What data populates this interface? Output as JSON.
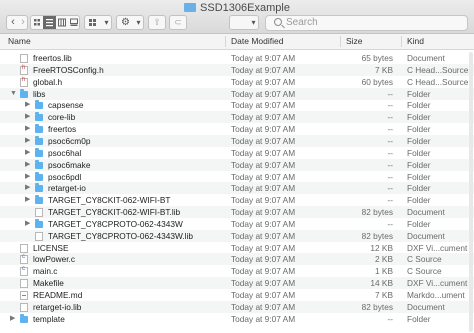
{
  "window": {
    "title": "SSD1306Example"
  },
  "toolbar": {
    "back_glyph": "‹",
    "forward_glyph": "›",
    "action_glyph": "⚙",
    "share_glyph": "⇪",
    "tag_glyph": "⊂",
    "dropdown_glyph": "▾"
  },
  "search": {
    "placeholder": "Search"
  },
  "columns": {
    "name": "Name",
    "date": "Date Modified",
    "size": "Size",
    "kind": "Kind"
  },
  "rows": [
    {
      "name": "freertos.lib",
      "date": "Today at 9:07 AM",
      "size": "65 bytes",
      "kind": "Document",
      "icon": "doc",
      "depth": 0,
      "expand": ""
    },
    {
      "name": "FreeRTOSConfig.h",
      "date": "Today at 9:07 AM",
      "size": "7 KB",
      "kind": "C Head...Source",
      "icon": "hdr",
      "depth": 0,
      "expand": ""
    },
    {
      "name": "global.h",
      "date": "Today at 9:07 AM",
      "size": "60 bytes",
      "kind": "C Head...Source",
      "icon": "hdr",
      "depth": 0,
      "expand": ""
    },
    {
      "name": "libs",
      "date": "Today at 9:07 AM",
      "size": "--",
      "kind": "Folder",
      "icon": "folder",
      "depth": 0,
      "expand": "▼"
    },
    {
      "name": "capsense",
      "date": "Today at 9:07 AM",
      "size": "--",
      "kind": "Folder",
      "icon": "folder",
      "depth": 1,
      "expand": "▶"
    },
    {
      "name": "core-lib",
      "date": "Today at 9:07 AM",
      "size": "--",
      "kind": "Folder",
      "icon": "folder",
      "depth": 1,
      "expand": "▶"
    },
    {
      "name": "freertos",
      "date": "Today at 9:07 AM",
      "size": "--",
      "kind": "Folder",
      "icon": "folder",
      "depth": 1,
      "expand": "▶"
    },
    {
      "name": "psoc6cm0p",
      "date": "Today at 9:07 AM",
      "size": "--",
      "kind": "Folder",
      "icon": "folder",
      "depth": 1,
      "expand": "▶"
    },
    {
      "name": "psoc6hal",
      "date": "Today at 9:07 AM",
      "size": "--",
      "kind": "Folder",
      "icon": "folder",
      "depth": 1,
      "expand": "▶"
    },
    {
      "name": "psoc6make",
      "date": "Today at 9:07 AM",
      "size": "--",
      "kind": "Folder",
      "icon": "folder",
      "depth": 1,
      "expand": "▶"
    },
    {
      "name": "psoc6pdl",
      "date": "Today at 9:07 AM",
      "size": "--",
      "kind": "Folder",
      "icon": "folder",
      "depth": 1,
      "expand": "▶"
    },
    {
      "name": "retarget-io",
      "date": "Today at 9:07 AM",
      "size": "--",
      "kind": "Folder",
      "icon": "folder",
      "depth": 1,
      "expand": "▶"
    },
    {
      "name": "TARGET_CY8CKIT-062-WIFI-BT",
      "date": "Today at 9:07 AM",
      "size": "--",
      "kind": "Folder",
      "icon": "folder",
      "depth": 1,
      "expand": "▶"
    },
    {
      "name": "TARGET_CY8CKIT-062-WIFI-BT.lib",
      "date": "Today at 9:07 AM",
      "size": "82 bytes",
      "kind": "Document",
      "icon": "doc",
      "depth": 1,
      "expand": ""
    },
    {
      "name": "TARGET_CY8CPROTO-062-4343W",
      "date": "Today at 9:07 AM",
      "size": "--",
      "kind": "Folder",
      "icon": "folder",
      "depth": 1,
      "expand": "▶"
    },
    {
      "name": "TARGET_CY8CPROTO-062-4343W.lib",
      "date": "Today at 9:07 AM",
      "size": "82 bytes",
      "kind": "Document",
      "icon": "doc",
      "depth": 1,
      "expand": ""
    },
    {
      "name": "LICENSE",
      "date": "Today at 9:07 AM",
      "size": "12 KB",
      "kind": "DXF Vi...cument",
      "icon": "doc",
      "depth": 0,
      "expand": ""
    },
    {
      "name": "lowPower.c",
      "date": "Today at 9:07 AM",
      "size": "2 KB",
      "kind": "C Source",
      "icon": "csrc",
      "depth": 0,
      "expand": ""
    },
    {
      "name": "main.c",
      "date": "Today at 9:07 AM",
      "size": "1 KB",
      "kind": "C Source",
      "icon": "csrc",
      "depth": 0,
      "expand": ""
    },
    {
      "name": "Makefile",
      "date": "Today at 9:07 AM",
      "size": "14 KB",
      "kind": "DXF Vi...cument",
      "icon": "doc",
      "depth": 0,
      "expand": ""
    },
    {
      "name": "README.md",
      "date": "Today at 9:07 AM",
      "size": "7 KB",
      "kind": "Markdo...ument",
      "icon": "md",
      "depth": 0,
      "expand": ""
    },
    {
      "name": "retarget-io.lib",
      "date": "Today at 9:07 AM",
      "size": "82 bytes",
      "kind": "Document",
      "icon": "doc",
      "depth": 0,
      "expand": ""
    },
    {
      "name": "template",
      "date": "Today at 9:07 AM",
      "size": "--",
      "kind": "Folder",
      "icon": "folder",
      "depth": 0,
      "expand": "▶"
    }
  ]
}
